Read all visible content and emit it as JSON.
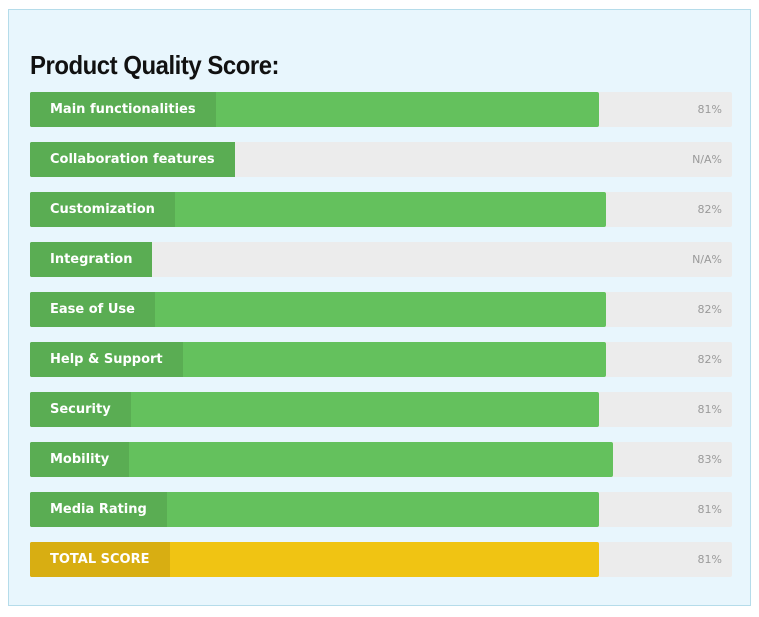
{
  "title": "Product Quality Score:",
  "colors": {
    "bar_fill": "#64c15d",
    "label_bg": "#5aad53",
    "track": "#ececec",
    "total_fill": "#f0c413",
    "total_label_bg": "#d8ae12",
    "panel_bg": "#e8f6fd"
  },
  "chart_data": {
    "type": "bar",
    "orientation": "horizontal",
    "title": "Product Quality Score:",
    "xlim": [
      0,
      100
    ],
    "unit": "%",
    "categories": [
      "Main functionalities",
      "Collaboration features",
      "Customization",
      "Integration",
      "Ease of Use",
      "Help & Support",
      "Security",
      "Mobility",
      "Media Rating",
      "TOTAL SCORE"
    ],
    "values": [
      81,
      null,
      82,
      null,
      82,
      82,
      81,
      83,
      81,
      81
    ],
    "value_labels": [
      "81%",
      "N/A%",
      "82%",
      "N/A%",
      "82%",
      "82%",
      "81%",
      "83%",
      "81%",
      "81%"
    ]
  }
}
